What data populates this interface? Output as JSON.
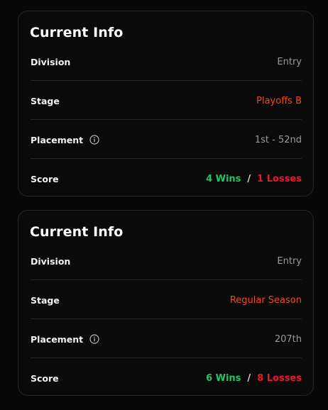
{
  "cards": [
    {
      "title": "Current Info",
      "division_label": "Division",
      "division_value": "Entry",
      "stage_label": "Stage",
      "stage_value": "Playoffs B",
      "placement_label": "Placement",
      "placement_value": "1st - 52nd",
      "score_label": "Score",
      "wins": "4 Wins",
      "separator": "/",
      "losses": "1 Losses"
    },
    {
      "title": "Current Info",
      "division_label": "Division",
      "division_value": "Entry",
      "stage_label": "Stage",
      "stage_value": "Regular Season",
      "placement_label": "Placement",
      "placement_value": "207th",
      "score_label": "Score",
      "wins": "6 Wins",
      "separator": "/",
      "losses": "8 Losses"
    }
  ],
  "icons": {
    "placement_info": "info-circle-icon"
  },
  "colors": {
    "background": "#070707",
    "card_border": "#262626",
    "stage_accent": "#ef4a23",
    "wins": "#22c55e",
    "losses": "#f0142f",
    "muted_value": "#9a9a9a"
  }
}
